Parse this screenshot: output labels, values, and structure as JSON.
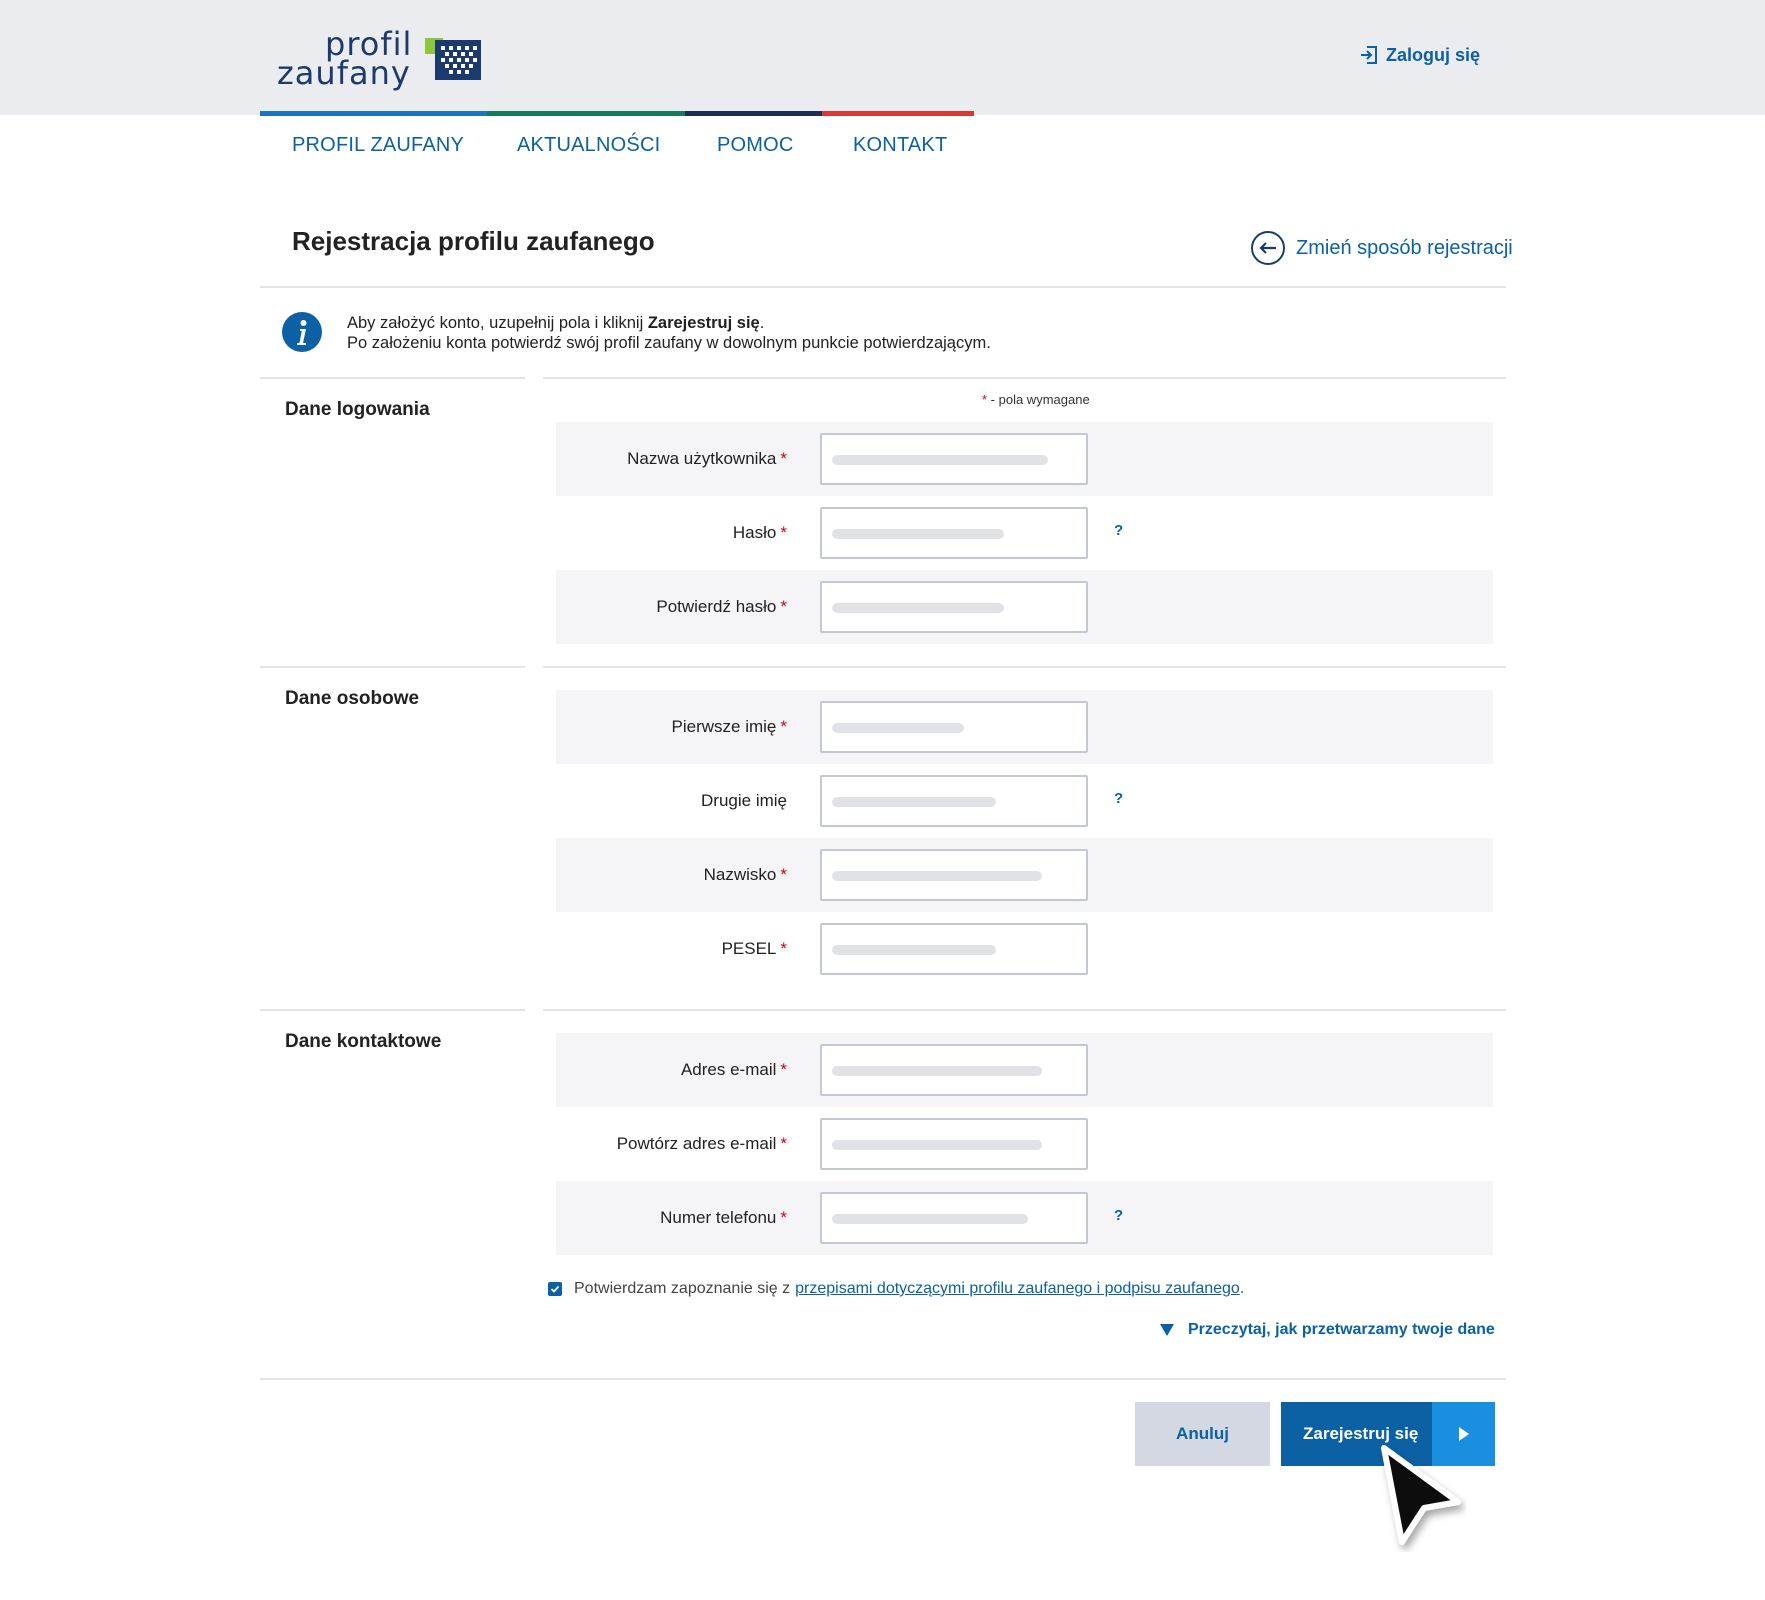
{
  "header": {
    "logo_line1": "profil",
    "logo_line2": "zaufany",
    "login_label": "Zaloguj się"
  },
  "nav": {
    "items": [
      "PROFIL ZAUFANY",
      "AKTUALNOŚCI",
      "POMOC",
      "KONTAKT"
    ]
  },
  "colors": {
    "accent": "#0b61a4",
    "stripe": [
      "#1a73c4",
      "#167a5c",
      "#1d2e56",
      "#d83a2d"
    ],
    "required": "#d0021b"
  },
  "page": {
    "title": "Rejestracja profilu zaufanego",
    "change_method_label": "Zmień sposób rejestracji"
  },
  "info": {
    "line1_pre": "Aby założyć konto, uzupełnij pola i kliknij ",
    "line1_bold": "Zarejestruj się",
    "line1_post": ".",
    "line2": "Po założeniu konta potwierdź swój profil zaufany w dowolnym punkcie potwierdzającym."
  },
  "required_star": "*",
  "required_legend": " - pola wymagane",
  "help_mark": "?",
  "sections": {
    "login": {
      "title": "Dane logowania",
      "fields": [
        {
          "label": "Nazwa użytkownika",
          "required": true,
          "value": ""
        },
        {
          "label": "Hasło",
          "required": true,
          "value": "",
          "help": true
        },
        {
          "label": "Potwierdź hasło",
          "required": true,
          "value": ""
        }
      ]
    },
    "personal": {
      "title": "Dane osobowe",
      "fields": [
        {
          "label": "Pierwsze imię",
          "required": true,
          "value": ""
        },
        {
          "label": "Drugie imię",
          "required": false,
          "value": "",
          "help": true
        },
        {
          "label": "Nazwisko",
          "required": true,
          "value": ""
        },
        {
          "label": "PESEL",
          "required": true,
          "value": ""
        }
      ]
    },
    "contact": {
      "title": "Dane kontaktowe",
      "fields": [
        {
          "label": "Adres e-mail",
          "required": true,
          "value": ""
        },
        {
          "label": "Powtórz adres e-mail",
          "required": true,
          "value": ""
        },
        {
          "label": "Numer telefonu",
          "required": true,
          "value": "",
          "help": true
        }
      ]
    }
  },
  "consent": {
    "checked": true,
    "text": "Potwierdzam zapoznanie się z",
    "link": "przepisami dotyczącymi profilu zaufanego i podpisu zaufanego",
    "end": "."
  },
  "privacy_link": "Przeczytaj, jak przetwarzamy twoje dane",
  "buttons": {
    "cancel": "Anuluj",
    "submit": "Zarejestruj się"
  }
}
